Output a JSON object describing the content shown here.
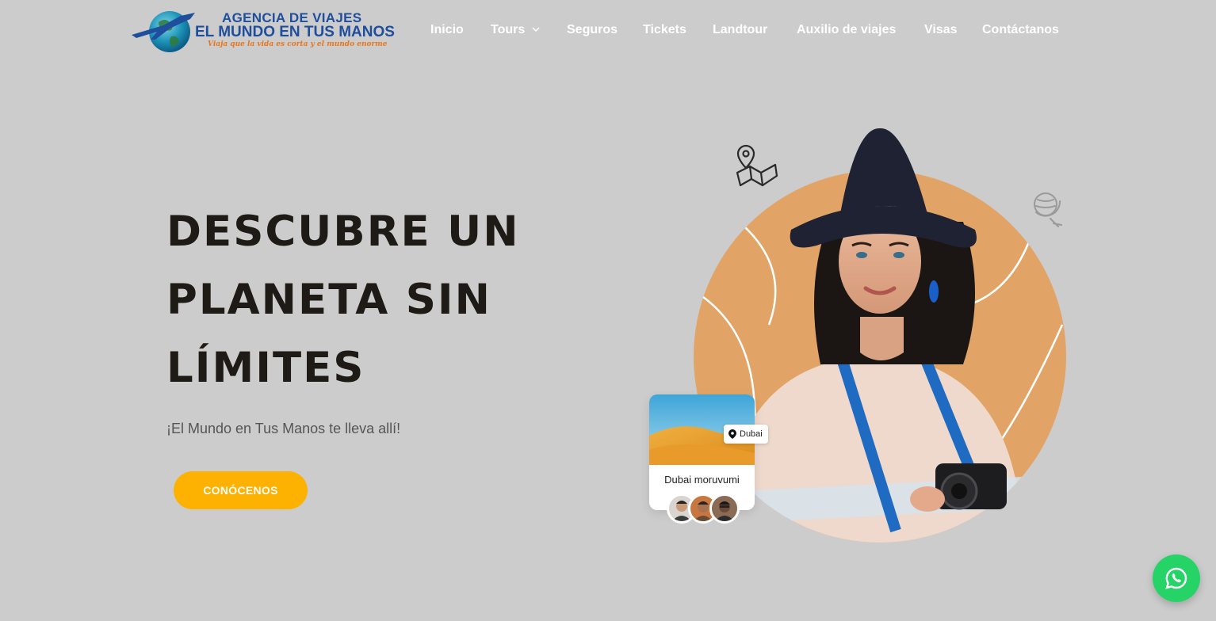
{
  "brand": {
    "line1": "AGENCIA DE VIAJES",
    "line2": "EL MUNDO EN TUS MANOS",
    "tagline": "Viaja que la vida es corta y el mundo enorme"
  },
  "nav": {
    "items": [
      "Inicio",
      "Tours",
      "Seguros",
      "Tickets",
      "Landtour",
      "Auxilio de viajes",
      "Visas",
      "Contáctanos"
    ],
    "dropdown_item": "Tours"
  },
  "hero": {
    "title_lines": [
      "DESCUBRE UN",
      "PLANETA SIN",
      "LÍMITES"
    ],
    "subtitle": "¡El Mundo en Tus Manos te lleva allí!",
    "cta_label": "CONÓCENOS"
  },
  "card": {
    "location": "Dubai",
    "title": "Dubai moruvumi"
  },
  "colors": {
    "page_bg": "#cccccc",
    "accent": "#fdb100",
    "circle": "#e2a466",
    "brand_blue": "#1f4e9c",
    "brand_orange": "#e8761c",
    "whatsapp": "#25d366"
  },
  "icons": [
    "globe-logo-icon",
    "chevron-down-icon",
    "map-pin-icon",
    "map-icon",
    "globe-icon",
    "whatsapp-icon"
  ]
}
